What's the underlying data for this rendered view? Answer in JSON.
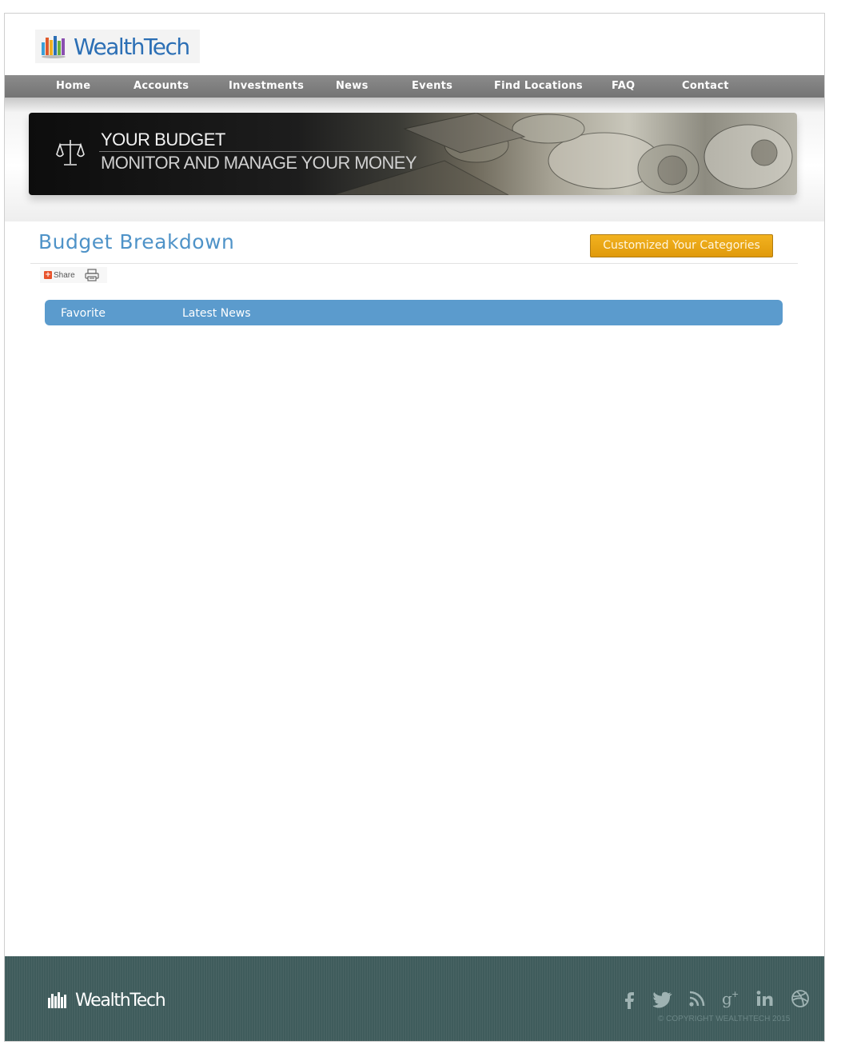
{
  "brand": {
    "name": "WealthTech"
  },
  "nav": [
    {
      "label": "Home"
    },
    {
      "label": "Accounts"
    },
    {
      "label": "Investments"
    },
    {
      "label": "News"
    },
    {
      "label": "Events"
    },
    {
      "label": "Find Locations"
    },
    {
      "label": "FAQ"
    },
    {
      "label": "Contact"
    }
  ],
  "banner": {
    "title": "YOUR BUDGET",
    "subtitle": "MONITOR AND MANAGE YOUR MONEY",
    "icon": "scales-icon"
  },
  "main": {
    "title": "Budget Breakdown",
    "customize_label": "Customized Your Categories",
    "share_label": "Share",
    "tabs": [
      {
        "label": "Favorite"
      },
      {
        "label": "Latest News"
      }
    ]
  },
  "footer": {
    "brand": "WealthTech",
    "social": [
      "facebook-icon",
      "twitter-icon",
      "rss-icon",
      "google-plus-icon",
      "linkedin-icon",
      "dribbble-icon"
    ],
    "copyright": "© COPYRIGHT WEALTHTECH 2015"
  },
  "colors": {
    "accent": "#5b9bcd",
    "nav_bg": "#7f7f7f",
    "button": "#e9a416",
    "footer_bg": "#3f5c5c",
    "title": "#4f93c8"
  }
}
